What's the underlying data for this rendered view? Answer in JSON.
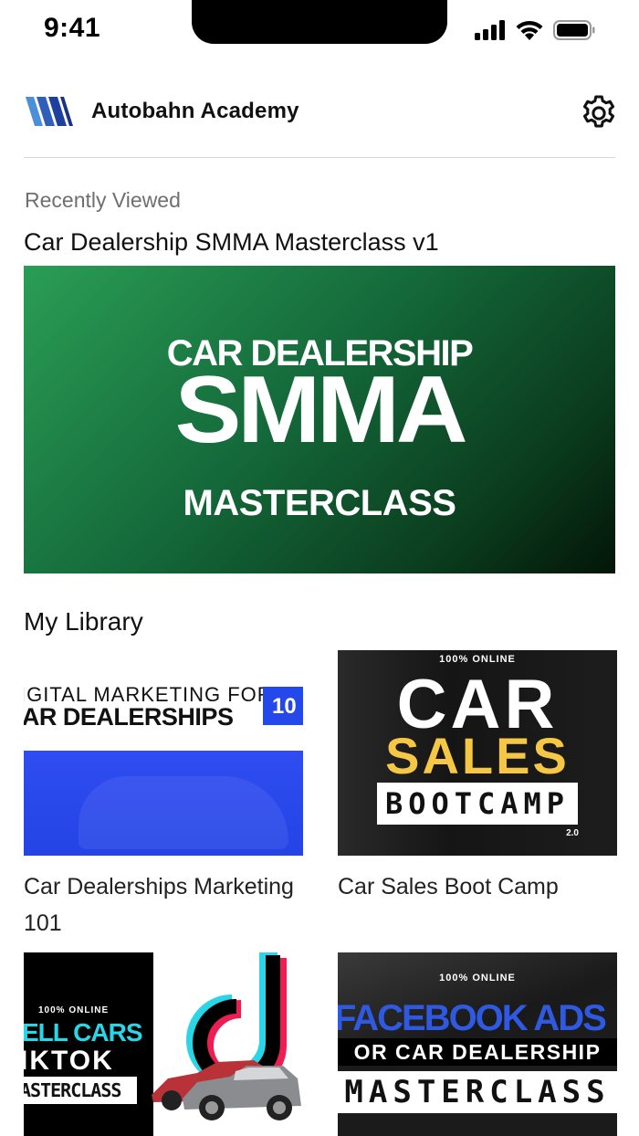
{
  "status": {
    "time": "9:41"
  },
  "header": {
    "app_name": "Autobahn Academy"
  },
  "recent": {
    "label": "Recently Viewed",
    "title": "Car Dealership SMMA Masterclass v1",
    "thumb": {
      "line1": "CAR DEALERSHIP",
      "line2": "SMMA",
      "line3": "MASTERCLASS"
    }
  },
  "library": {
    "heading": "My Library",
    "courses": [
      {
        "title": "Car Dealerships Marketing 101",
        "thumb": {
          "line1": "IGITAL MARKETING FOR",
          "line2": "'AR DEALERSHIPS",
          "badge": "10"
        }
      },
      {
        "title": "Car Sales Boot Camp",
        "thumb": {
          "online": "100% ONLINE",
          "car": "CAR",
          "sales": "SALES",
          "boot": "BOOTCAMP",
          "version": "2.0"
        }
      },
      {
        "title": "",
        "thumb": {
          "online": "100% ONLINE",
          "line1": "ELL CARS",
          "line2": "IKTOK",
          "line3": "ASTERCLASS"
        }
      },
      {
        "title": "",
        "thumb": {
          "online": "100% ONLINE",
          "line1": "FACEBOOK ADS",
          "line2": "OR CAR DEALERSHIP",
          "line3": "MASTERCLASS"
        }
      }
    ]
  },
  "colors": {
    "accent_blue": "#2448ea",
    "logo_blue": "#1f3f9f",
    "hero_green": "#14693a",
    "sales_yellow": "#f6c744",
    "tiktok_cyan": "#29d6e8",
    "tiktok_pink": "#ee1d52"
  }
}
